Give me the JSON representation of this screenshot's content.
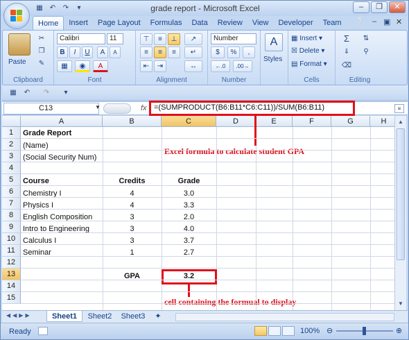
{
  "window": {
    "title": "grade report - Microsoft Excel"
  },
  "tabs": [
    "Home",
    "Insert",
    "Page Layout",
    "Formulas",
    "Data",
    "Review",
    "View",
    "Developer",
    "Team"
  ],
  "ribbon": {
    "clipboard": {
      "label": "Clipboard",
      "paste": "Paste"
    },
    "font": {
      "label": "Font",
      "name": "Calibri",
      "size": "11",
      "bold": "B",
      "italic": "I",
      "underline": "U",
      "grow": "A",
      "shrink": "A"
    },
    "alignment": {
      "label": "Alignment"
    },
    "number": {
      "label": "Number",
      "format": "Number",
      "currency": "$",
      "percent": "%",
      "comma": ","
    },
    "styles": {
      "label": "Styles"
    },
    "cells": {
      "label": "Cells",
      "insert": "Insert",
      "delete": "Delete",
      "format": "Format"
    },
    "editing": {
      "label": "Editing"
    }
  },
  "formula_bar": {
    "name_box": "C13",
    "fx": "fx",
    "formula": "=(SUMPRODUCT(B6:B11*C6:C11))/SUM(B6:B11)"
  },
  "columns": [
    "A",
    "B",
    "C",
    "D",
    "E",
    "F",
    "G",
    "H"
  ],
  "rows": [
    "1",
    "2",
    "3",
    "4",
    "5",
    "6",
    "7",
    "8",
    "9",
    "10",
    "11",
    "12",
    "13",
    "14",
    "15"
  ],
  "cells": {
    "a1": "Grade Report",
    "a2": "(Name)",
    "a3": "(Social Security Num)",
    "a5": "Course",
    "b5": "Credits",
    "c5": "Grade",
    "table": [
      {
        "course": "Chemistry I",
        "credits": "4",
        "grade": "3.0"
      },
      {
        "course": "Physics I",
        "credits": "4",
        "grade": "3.3"
      },
      {
        "course": "English Composition",
        "credits": "3",
        "grade": "2.0"
      },
      {
        "course": "Intro to Engineering",
        "credits": "3",
        "grade": "4.0"
      },
      {
        "course": "Calculus I",
        "credits": "3",
        "grade": "3.7"
      },
      {
        "course": "Seminar",
        "credits": "1",
        "grade": "2.7"
      }
    ],
    "b13": "GPA",
    "c13": "3.2"
  },
  "annotations": {
    "formula": "Excel formula to calculate student GPA",
    "cell": "cell containing the formual to display"
  },
  "sheets": [
    "Sheet1",
    "Sheet2",
    "Sheet3"
  ],
  "status": {
    "ready": "Ready",
    "zoom": "100%"
  },
  "colors": {
    "accent": "#e0101a",
    "selected_header": "#f2c365"
  }
}
